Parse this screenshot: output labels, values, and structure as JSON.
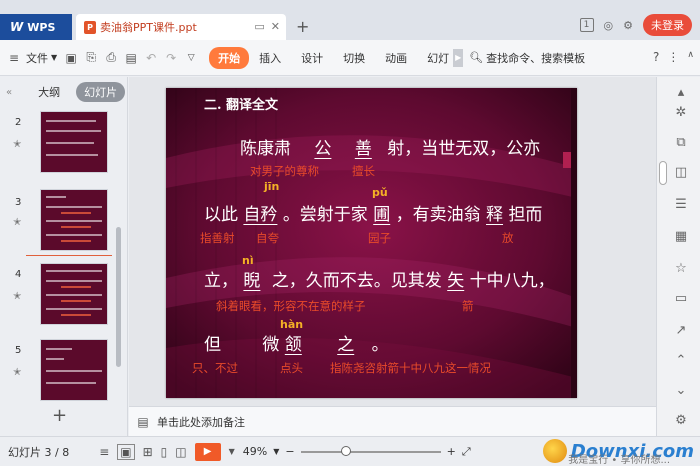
{
  "app": {
    "brand": "WPS",
    "doc_title": "卖油翁PPT课件.ppt",
    "file_type_icon_label": "P",
    "window_count_badge": "1",
    "login_label": "未登录"
  },
  "ribbon": {
    "file_menu": "文件",
    "tabs": [
      "开始",
      "插入",
      "设计",
      "切换",
      "动画",
      "幻灯"
    ],
    "active_tab": "开始",
    "search_label": "查找命令、搜索模板"
  },
  "left_panel": {
    "tab_outline": "大纲",
    "tab_slides": "幻灯片",
    "thumb_numbers": [
      "2",
      "3",
      "4",
      "5"
    ]
  },
  "slide": {
    "heading": "二. 翻译全文",
    "row1": {
      "a": "陈康肃",
      "b": "公",
      "c": "善",
      "d": "射，当世无双，公亦"
    },
    "note1": {
      "a": "对男子的尊称",
      "b": "擅长"
    },
    "pinyin1": {
      "a": "jīn",
      "b": "pǔ"
    },
    "row2": {
      "a": "以此",
      "b": "自矜",
      "c": "。尝射于家",
      "d": "圃",
      "e": "，有卖油翁",
      "f": "释",
      "g": "担而"
    },
    "note2": {
      "a": "指善射",
      "b": "自夸",
      "c": "园子",
      "d": "放"
    },
    "pinyin2": "nì",
    "row3": {
      "a": "立，",
      "b": "睨",
      "c": "之，久而不去。见其发",
      "d": "矢",
      "e": "十中八九，"
    },
    "note3": {
      "a": "斜着眼看，形容不在意的样子",
      "b": "箭"
    },
    "pinyin3": "hàn",
    "row4": {
      "a": "但",
      "b": "微",
      "c": "颔",
      "d": "之",
      "e": "。"
    },
    "note4": {
      "a": "只、不过",
      "b": "点头",
      "c": "指陈尧咨射箭十中八九这一情况"
    }
  },
  "notes_bar": {
    "placeholder": "单击此处添加备注"
  },
  "status": {
    "slide_counter": "幻灯片 3 / 8",
    "zoom": "49%",
    "watermark": "Downxi.com",
    "watermark_sub": "我是宝行 • 享你所想..."
  },
  "colors": {
    "slide_bg": "#4a0724",
    "accent": "#ff7a3c",
    "note_red": "#e84a2a",
    "pinyin_gold": "#f5b126"
  }
}
